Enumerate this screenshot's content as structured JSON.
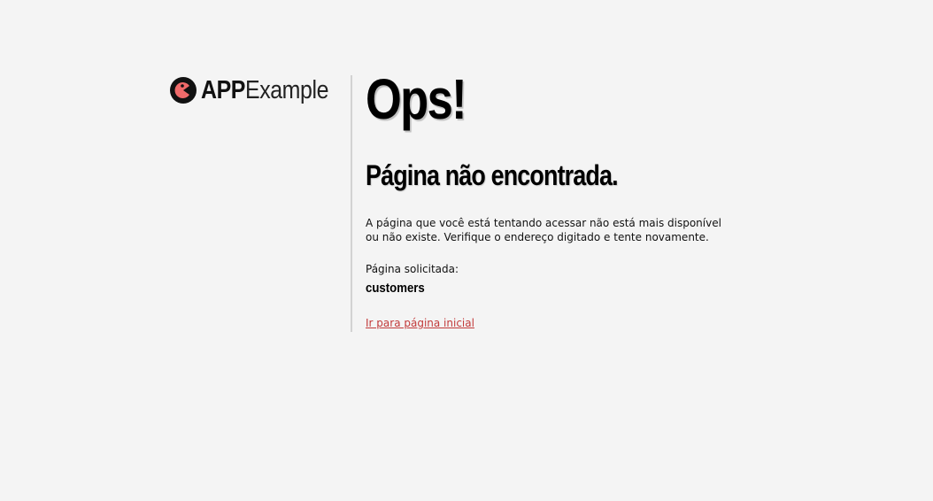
{
  "brand": {
    "name_strong": "APP",
    "name_light": "Example",
    "icon": "pacman-logo-icon",
    "icon_colors": {
      "outer": "#111111",
      "inner": "#f06a6a",
      "eye": "#111111"
    }
  },
  "error": {
    "title": "Ops!",
    "subtitle": "Página não encontrada.",
    "message": "A página que você está tentando acessar não está mais disponível ou não existe. Verifique o endereço digitado e tente novamente.",
    "requested_label": "Página solicitada:",
    "requested_value": "customers",
    "home_link_label": "Ir para página inicial"
  },
  "colors": {
    "background": "#f4f4f4",
    "divider": "#d2d2d2",
    "link": "#c23a3a"
  }
}
